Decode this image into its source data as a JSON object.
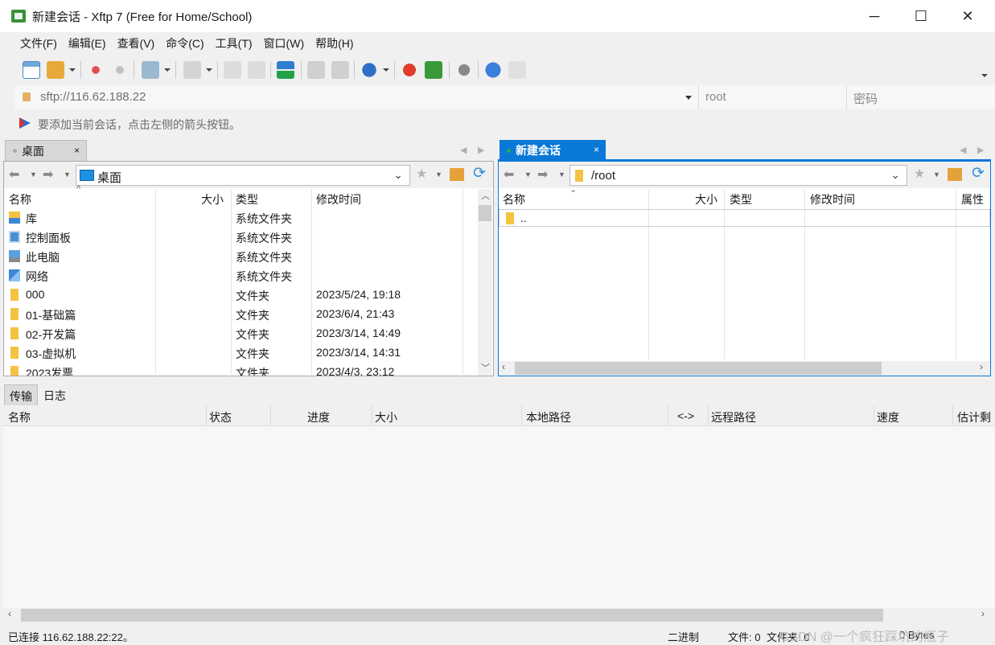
{
  "window": {
    "title": "新建会话 - Xftp 7 (Free for Home/School)",
    "minimize": "─",
    "maximize": "☐",
    "close": "✕"
  },
  "menu": [
    "文件(F)",
    "编辑(E)",
    "查看(V)",
    "命令(C)",
    "工具(T)",
    "窗口(W)",
    "帮助(H)"
  ],
  "address": {
    "url": "sftp://116.62.188.22",
    "user_placeholder": "root",
    "password_placeholder": "密码"
  },
  "hint": "要添加当前会话，点击左侧的箭头按钮。",
  "local_tab": {
    "label": "桌面",
    "close": "×"
  },
  "remote_tab": {
    "label": "新建会话",
    "close": "×"
  },
  "local": {
    "path": "桌面",
    "columns": [
      "名称",
      "大小",
      "类型",
      "修改时间"
    ],
    "rows": [
      {
        "name": "库",
        "size": "",
        "type": "系统文件夹",
        "modified": "",
        "icon": "library-icon"
      },
      {
        "name": "控制面板",
        "size": "",
        "type": "系统文件夹",
        "modified": "",
        "icon": "control-panel-icon"
      },
      {
        "name": "此电脑",
        "size": "",
        "type": "系统文件夹",
        "modified": "",
        "icon": "computer-icon"
      },
      {
        "name": "网络",
        "size": "",
        "type": "系统文件夹",
        "modified": "",
        "icon": "network-icon"
      },
      {
        "name": "000",
        "size": "",
        "type": "文件夹",
        "modified": "2023/5/24, 19:18",
        "icon": "folder-icon"
      },
      {
        "name": "01-基础篇",
        "size": "",
        "type": "文件夹",
        "modified": "2023/6/4, 21:43",
        "icon": "folder-icon"
      },
      {
        "name": "02-开发篇",
        "size": "",
        "type": "文件夹",
        "modified": "2023/3/14, 14:49",
        "icon": "folder-icon"
      },
      {
        "name": "03-虚拟机",
        "size": "",
        "type": "文件夹",
        "modified": "2023/3/14, 14:31",
        "icon": "folder-icon"
      },
      {
        "name": "2023发票",
        "size": "",
        "type": "文件夹",
        "modified": "2023/4/3, 23:12",
        "icon": "folder-icon"
      }
    ]
  },
  "remote": {
    "path": "/root",
    "columns": [
      "名称",
      "大小",
      "类型",
      "修改时间",
      "属性"
    ],
    "rows": [
      {
        "name": "..",
        "icon": "folder-icon"
      }
    ]
  },
  "bottom_tabs": [
    "传输",
    "日志"
  ],
  "transfer_columns": [
    "名称",
    "状态",
    "进度",
    "大小",
    "本地路径",
    "<->",
    "远程路径",
    "速度",
    "估计剩"
  ],
  "status": {
    "connected": "已连接 116.62.188.22:22。",
    "mode": "二进制",
    "files": "文件: 0",
    "folders": "文件夹: 0",
    "bytes": "0 Bytes",
    "watermark": "CSDN @一个疯狂踩坑的瓶子"
  },
  "colors": {
    "accent": "#0a78d7",
    "active_dot": "#22b14c",
    "folder": "#f5c342"
  }
}
